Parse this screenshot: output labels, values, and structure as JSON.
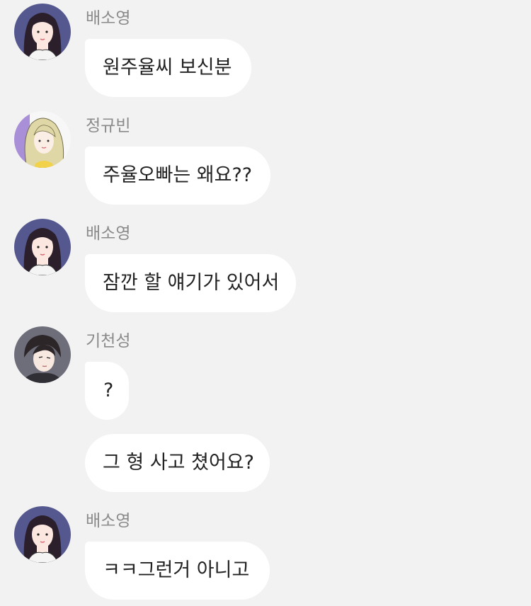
{
  "messages": [
    {
      "sender": "배소영",
      "text": "원주율씨 보신분",
      "avatar": "sooyoung-avatar"
    },
    {
      "sender": "정규빈",
      "text": "주율오빠는 왜요??",
      "avatar": "gyubin-avatar"
    },
    {
      "sender": "배소영",
      "text": "잠깐 할 얘기가 있어서",
      "avatar": "sooyoung-avatar"
    },
    {
      "sender": "기천성",
      "texts": [
        "?",
        "그 형 사고 쳤어요?"
      ],
      "avatar": "cheonseong-avatar"
    },
    {
      "sender": "배소영",
      "text": "ㅋㅋ그런거 아니고",
      "avatar": "sooyoung-avatar"
    }
  ],
  "colors": {
    "background": "#f2f2f2",
    "bubble": "#ffffff",
    "sender_name": "#8a8a8a",
    "message_text": "#222222"
  }
}
